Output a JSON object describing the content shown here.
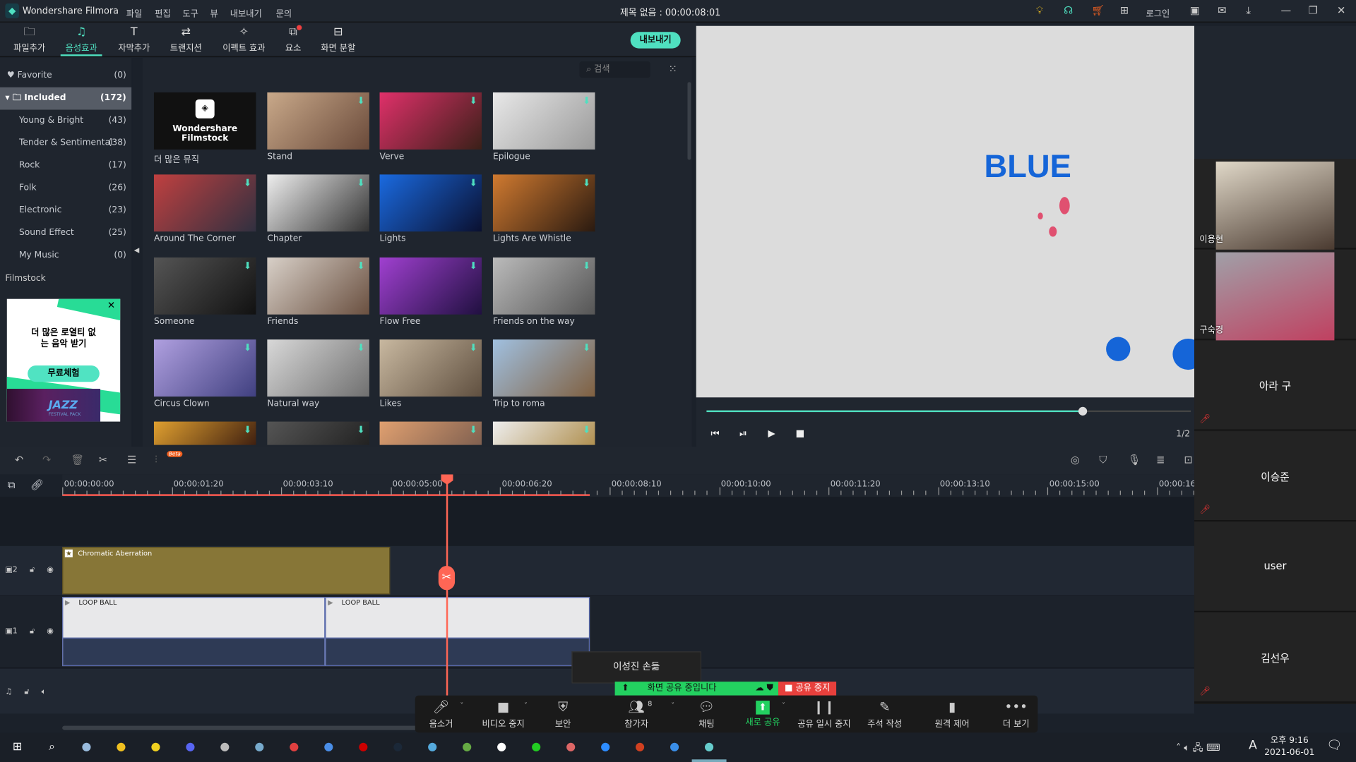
{
  "app": {
    "name": "Wondershare Filmora",
    "project_title": "제목 없음 : 00:00:08:01",
    "menu": [
      "파일",
      "편집",
      "도구",
      "뷰",
      "내보내기",
      "문의"
    ],
    "login": "로그인"
  },
  "tabs": [
    {
      "label": "파일추가",
      "icon": "folder-icon"
    },
    {
      "label": "음성효과",
      "icon": "music-note-icon",
      "active": true
    },
    {
      "label": "자막추가",
      "icon": "text-icon"
    },
    {
      "label": "트랜지션",
      "icon": "transition-icon"
    },
    {
      "label": "이펙트 효과",
      "icon": "effects-icon"
    },
    {
      "label": "요소",
      "icon": "elements-icon"
    },
    {
      "label": "화면 분할",
      "icon": "split-screen-icon"
    }
  ],
  "export_label": "내보내기",
  "sidebar": {
    "favorite": {
      "label": "Favorite",
      "count": "(0)"
    },
    "included": {
      "label": "Included",
      "count": "(172)"
    },
    "items": [
      {
        "label": "Young & Bright",
        "count": "(43)"
      },
      {
        "label": "Tender & Sentimental",
        "count": "(38)"
      },
      {
        "label": "Rock",
        "count": "(17)"
      },
      {
        "label": "Folk",
        "count": "(26)"
      },
      {
        "label": "Electronic",
        "count": "(23)"
      },
      {
        "label": "Sound Effect",
        "count": "(25)"
      },
      {
        "label": "My Music",
        "count": "(0)"
      }
    ],
    "filmstock": "Filmstock",
    "ad": {
      "text1": "더 많은 로열티 없",
      "text2": "는 음악 받기",
      "button": "무료체험",
      "jazz": "JAZZ",
      "jazz_sub": "FESTIVAL PACK"
    }
  },
  "library": {
    "search_placeholder": "검색",
    "filmstock_tile": "Wondershare Filmstock",
    "items": [
      {
        "label": "더 많은 뮤직",
        "colors": [
          "#111",
          "#222"
        ]
      },
      {
        "label": "Stand",
        "colors": [
          "#c9a98a",
          "#6a4a3a"
        ]
      },
      {
        "label": "Verve",
        "colors": [
          "#e0306a",
          "#3a2018"
        ]
      },
      {
        "label": "Epilogue",
        "colors": [
          "#e8e8e8",
          "#9a9a9a"
        ]
      },
      {
        "label": "Around The Corner",
        "colors": [
          "#c04040",
          "#303040"
        ]
      },
      {
        "label": "Chapter",
        "colors": [
          "#eeeeee",
          "#333"
        ]
      },
      {
        "label": "Lights",
        "colors": [
          "#1a6ae0",
          "#0a1030"
        ]
      },
      {
        "label": "Lights Are Whistle",
        "colors": [
          "#d07a30",
          "#2a1a10"
        ]
      },
      {
        "label": "Someone",
        "colors": [
          "#555",
          "#111"
        ]
      },
      {
        "label": "Friends",
        "colors": [
          "#d8d0c8",
          "#6a5040"
        ]
      },
      {
        "label": "Flow Free",
        "colors": [
          "#a040d0",
          "#201040"
        ]
      },
      {
        "label": "Friends on the way",
        "colors": [
          "#bbb",
          "#555"
        ]
      },
      {
        "label": "Circus Clown",
        "colors": [
          "#b0a0e0",
          "#404080"
        ]
      },
      {
        "label": "Natural way",
        "colors": [
          "#d8d8d8",
          "#707070"
        ]
      },
      {
        "label": "Likes",
        "colors": [
          "#c8b8a0",
          "#605040"
        ]
      },
      {
        "label": "Trip to roma",
        "colors": [
          "#a0c0e0",
          "#806040"
        ]
      },
      {
        "label": "",
        "colors": [
          "#e0a030",
          "#402010"
        ]
      },
      {
        "label": "",
        "colors": [
          "#555",
          "#222"
        ]
      },
      {
        "label": "",
        "colors": [
          "#e0a070",
          "#806050"
        ]
      },
      {
        "label": "",
        "colors": [
          "#eee",
          "#b09050"
        ]
      }
    ]
  },
  "preview": {
    "text": "BLUE",
    "page": "1/2",
    "progress": 0.78
  },
  "participants": [
    {
      "name": "이용현",
      "video": true
    },
    {
      "name": "구숙경",
      "video": true
    },
    {
      "name": "아라 구"
    },
    {
      "name": "이승준"
    },
    {
      "name": "user"
    },
    {
      "name": "김선우"
    }
  ],
  "timeline": {
    "ruler": [
      "00:00:00:00",
      "00:00:01:20",
      "00:00:03:10",
      "00:00:05:00",
      "00:00:06:20",
      "00:00:08:10",
      "00:00:10:00",
      "00:00:11:20",
      "00:00:13:10",
      "00:00:15:00",
      "00:00:16:"
    ],
    "beta": "Beta",
    "fx_clip": "Chromatic Aberration",
    "video_clips": [
      "LOOP BALL",
      "LOOP BALL"
    ],
    "tracks": [
      "2",
      "1"
    ]
  },
  "zoom": {
    "tooltip": "이성진 손듦",
    "sharing": "화면 공유 중입니다",
    "stop_share": "공유 중지",
    "participants_count": "8",
    "buttons": [
      "음소거",
      "비디오 중지",
      "보안",
      "참가자",
      "채팅",
      "새로 공유",
      "공유 일시 중지",
      "주석 작성",
      "원격 제어",
      "더 보기"
    ]
  },
  "taskbar": {
    "time": "오후 9:16",
    "date": "2021-06-01",
    "ime": "A"
  },
  "colors": {
    "accent": "#4fe0c0",
    "playhead": "#ff6655",
    "zoom_green": "#23d160",
    "zoom_red": "#e8403c"
  }
}
